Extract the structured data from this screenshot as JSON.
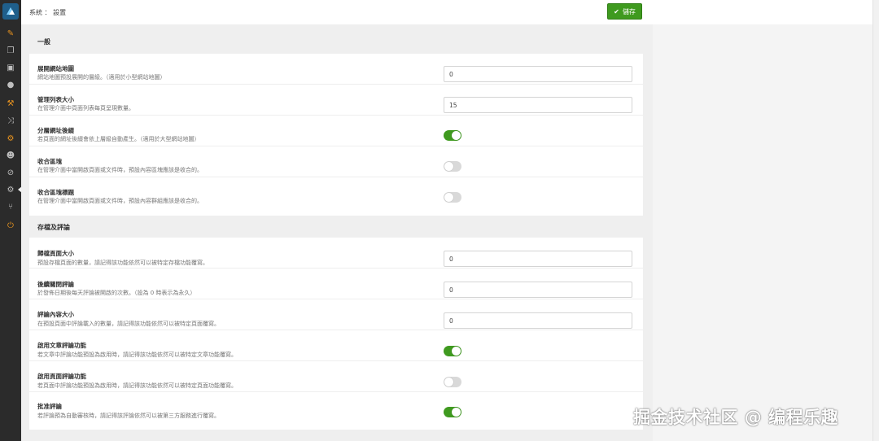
{
  "breadcrumb": "系統 ： 設置",
  "save_label": "儲存",
  "sidebar": {
    "items": [
      {
        "icon": "pencil-icon"
      },
      {
        "icon": "copy-icon"
      },
      {
        "icon": "images-icon"
      },
      {
        "icon": "comments-icon"
      },
      {
        "icon": "wrench-icon"
      },
      {
        "icon": "shuffle-icon"
      },
      {
        "icon": "gear-icon"
      },
      {
        "icon": "users-icon"
      },
      {
        "icon": "eye-slash-icon"
      },
      {
        "icon": "cogs-icon"
      },
      {
        "icon": "branch-icon"
      },
      {
        "icon": "power-icon"
      }
    ]
  },
  "sections": {
    "general": {
      "title": "一般",
      "rows": [
        {
          "label": "展開網站地圖",
          "desc": "網站地圖預設展開的層級。（適用於小型網站地圖）",
          "type": "input",
          "value": "0"
        },
        {
          "label": "管理列表大小",
          "desc": "在管理介面中頁面列表每頁呈現數量。",
          "type": "input",
          "value": "15"
        },
        {
          "label": "分層網址後綴",
          "desc": "若頁面的網址後綴會依上層級自動產生。（適用於大型網站地圖）",
          "type": "toggle",
          "on": true
        },
        {
          "label": "收合區塊",
          "desc": "在管理介面中當開啟頁面或文件時，預設內容區塊應該是收合的。",
          "type": "toggle",
          "on": false
        },
        {
          "label": "收合區塊標題",
          "desc": "在管理介面中當開啟頁面或文件時，預設內容群組應該是收合的。",
          "type": "toggle",
          "on": false
        }
      ]
    },
    "archive": {
      "title": "存檔及評論",
      "rows": [
        {
          "label": "歸檔頁面大小",
          "desc": "預設存檔頁面的數量，請記得該功能依然可以被特定存檔功能覆寫。",
          "type": "input",
          "value": "0"
        },
        {
          "label": "後續關閉評論",
          "desc": "於發佈日期後每天評論被開啟的次數。（設為 0 時表示為永久）",
          "type": "input",
          "value": "0"
        },
        {
          "label": "評論內容大小",
          "desc": "在預設頁面中評論載入的數量，請記得該功能依然可以被特定頁面覆寫。",
          "type": "input",
          "value": "0"
        },
        {
          "label": "啟用文章評論功能",
          "desc": "若文章中評論功能預設為啟用時，請記得該功能依然可以被特定文章功能覆寫。",
          "type": "toggle",
          "on": true
        },
        {
          "label": "啟用頁面評論功能",
          "desc": "若頁面中評論功能預設為啟用時，請記得該功能依然可以被特定頁面功能覆寫。",
          "type": "toggle",
          "on": false
        },
        {
          "label": "批准評論",
          "desc": "若評論預為自動審核時，請記得該評論依然可以被第三方服務進行覆寫。",
          "type": "toggle",
          "on": true
        }
      ]
    }
  },
  "watermark": "掘金技术社区 @ 编程乐趣",
  "colors": {
    "accent": "#3f9a1f",
    "sidebar": "#2b2b2b",
    "icon_orange": "#e8931f"
  }
}
